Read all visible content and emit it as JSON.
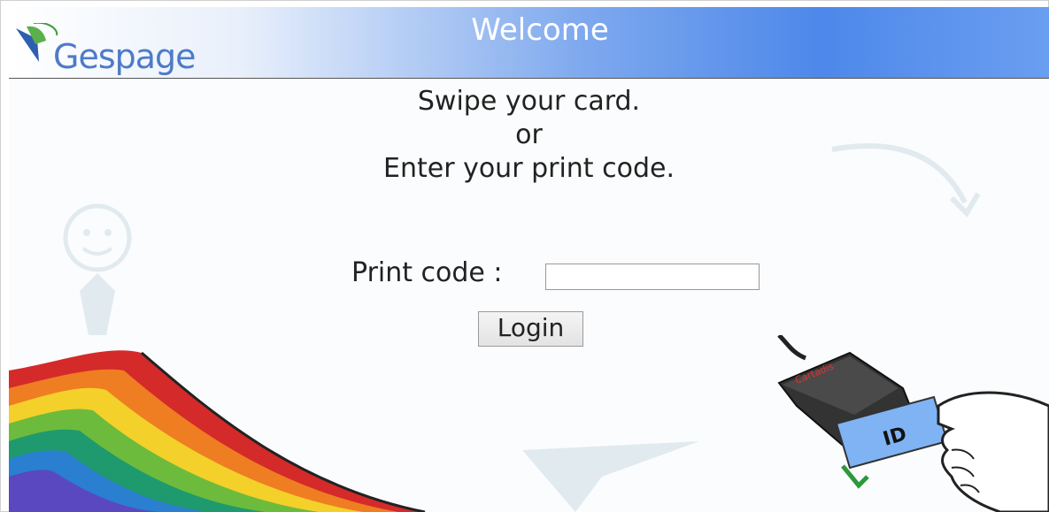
{
  "header": {
    "logo_text": "Gespage",
    "title": "Welcome"
  },
  "instructions": {
    "line1": "Swipe your card.",
    "line2": "or",
    "line3": "Enter your print code."
  },
  "form": {
    "print_code_label": "Print code :",
    "print_code_value": "",
    "login_label": "Login"
  },
  "illustration": {
    "reader_brand": "Cartadis",
    "card_text": "ID"
  }
}
